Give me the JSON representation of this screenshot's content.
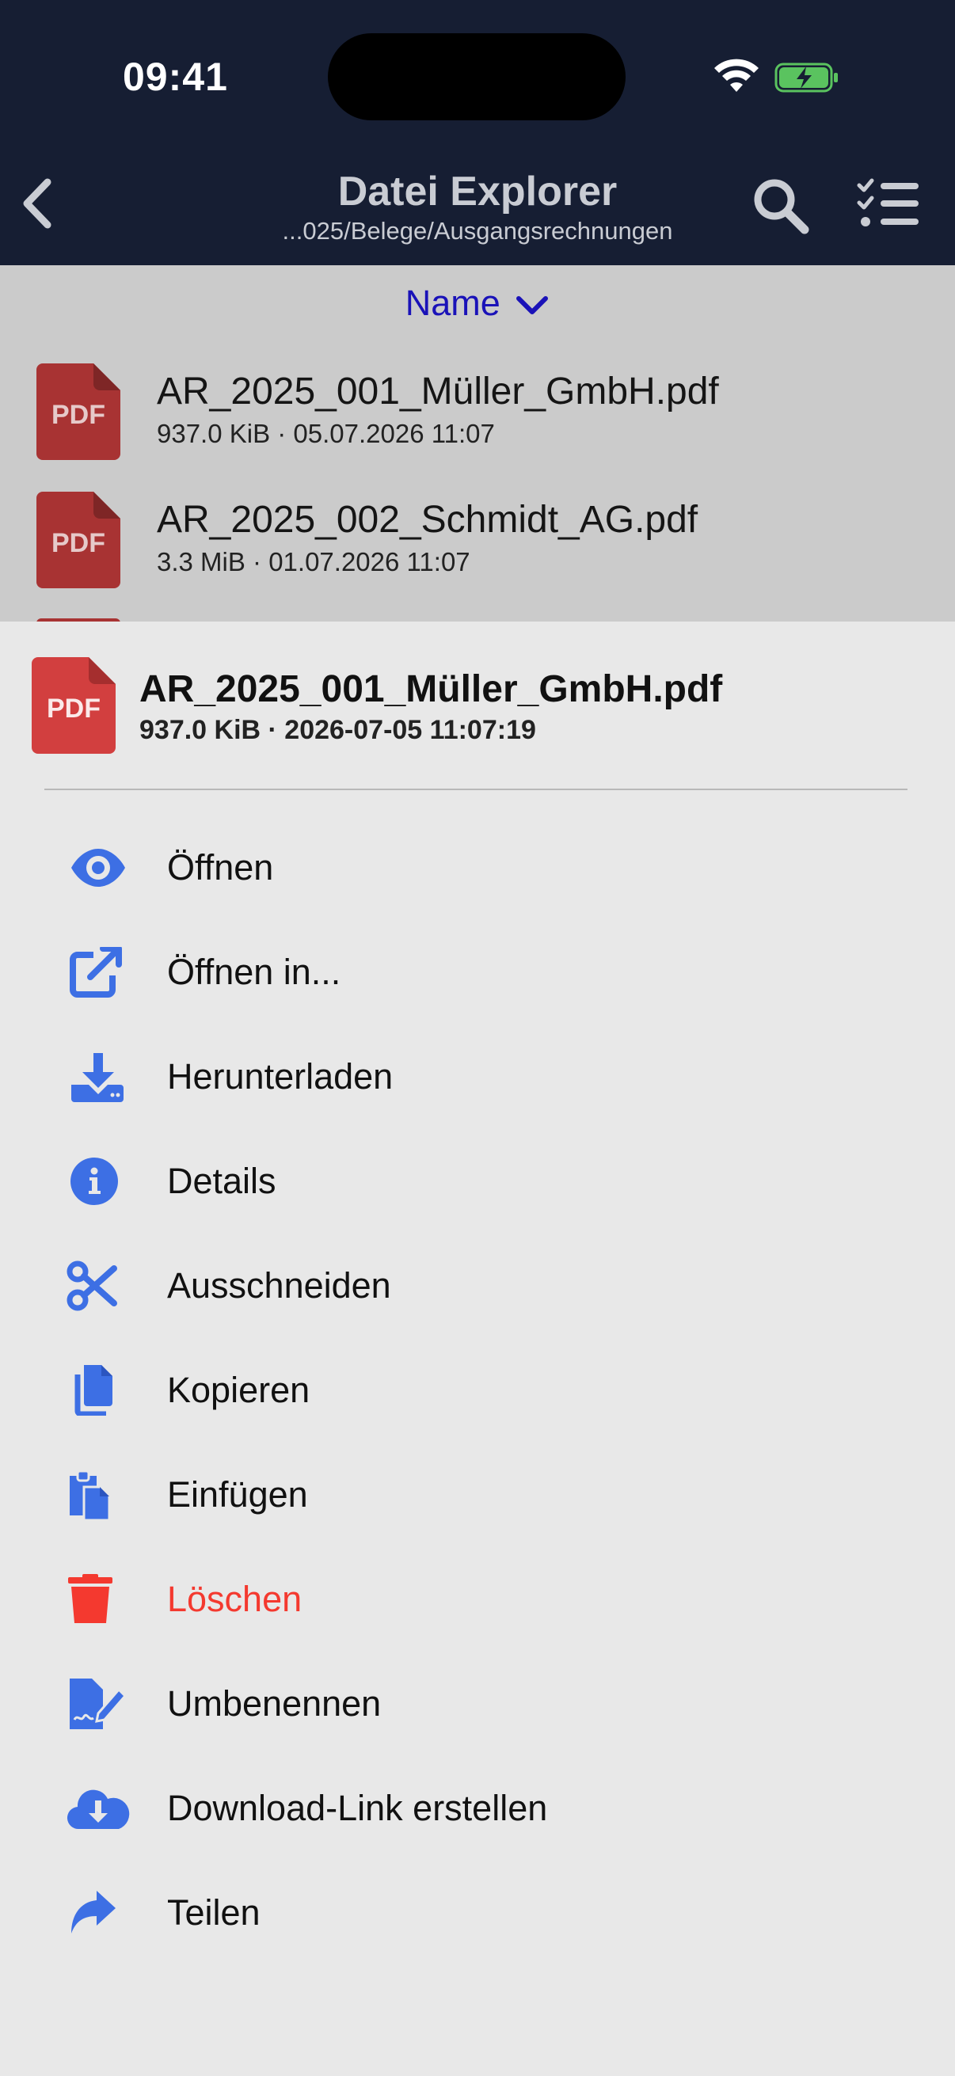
{
  "status": {
    "time": "09:41"
  },
  "nav": {
    "title": "Datei Explorer",
    "subtitle": "...025/Belege/Ausgangsrechnungen"
  },
  "sort": {
    "label": "Name"
  },
  "files": [
    {
      "name": "AR_2025_001_Müller_GmbH.pdf",
      "meta": "937.0 KiB · 05.07.2026 11:07",
      "icon_label": "PDF"
    },
    {
      "name": "AR_2025_002_Schmidt_AG.pdf",
      "meta": "3.3 MiB · 01.07.2026 11:07",
      "icon_label": "PDF"
    }
  ],
  "sheet": {
    "file_name": "AR_2025_001_Müller_GmbH.pdf",
    "file_meta": "937.0 KiB · 2026-07-05 11:07:19",
    "icon_label": "PDF",
    "actions": [
      {
        "label": "Öffnen",
        "icon": "eye-icon"
      },
      {
        "label": "Öffnen in...",
        "icon": "external-link-icon"
      },
      {
        "label": "Herunterladen",
        "icon": "download-icon"
      },
      {
        "label": "Details",
        "icon": "info-icon"
      },
      {
        "label": "Ausschneiden",
        "icon": "scissors-icon"
      },
      {
        "label": "Kopieren",
        "icon": "copy-icon"
      },
      {
        "label": "Einfügen",
        "icon": "paste-icon"
      },
      {
        "label": "Löschen",
        "icon": "trash-icon"
      },
      {
        "label": "Umbenennen",
        "icon": "rename-icon"
      },
      {
        "label": "Download-Link erstellen",
        "icon": "cloud-download-icon"
      },
      {
        "label": "Teilen",
        "icon": "share-icon"
      }
    ]
  },
  "colors": {
    "header_bg": "#161e33",
    "accent_blue": "#3d6fe4",
    "danger_red": "#f4392f",
    "pdf_red": "#d23f3f",
    "sort_blue": "#1a12b8"
  }
}
